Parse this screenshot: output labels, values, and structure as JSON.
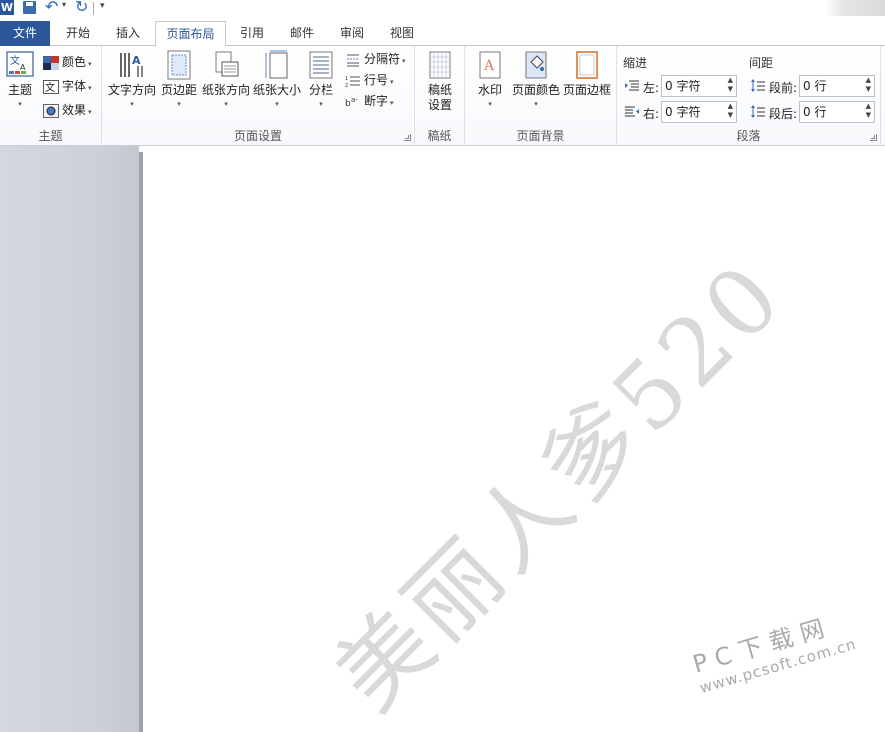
{
  "quick_access": {
    "app_icon_letter": "W",
    "icons": [
      "word-icon",
      "save-icon",
      "undo-icon",
      "redo-icon",
      "customize-icon"
    ]
  },
  "tabs": [
    {
      "label": "文件",
      "active": false
    },
    {
      "label": "开始",
      "active": false
    },
    {
      "label": "插入",
      "active": false
    },
    {
      "label": "页面布局",
      "active": true
    },
    {
      "label": "引用",
      "active": false
    },
    {
      "label": "邮件",
      "active": false
    },
    {
      "label": "审阅",
      "active": false
    },
    {
      "label": "视图",
      "active": false
    }
  ],
  "ribbon": {
    "theme_group": {
      "label": "主题",
      "theme_button": "主题",
      "colors": "颜色",
      "fonts": "字体",
      "effects": "效果"
    },
    "page_setup_group": {
      "label": "页面设置",
      "text_direction": "文字方向",
      "margins": "页边距",
      "orientation": "纸张方向",
      "size": "纸张大小",
      "columns": "分栏",
      "breaks": "分隔符",
      "line_numbers": "行号",
      "hyphenation": "断字"
    },
    "manuscript_group": {
      "label": "稿纸",
      "settings_line1": "稿纸",
      "settings_line2": "设置"
    },
    "page_background_group": {
      "label": "页面背景",
      "watermark": "水印",
      "page_color": "页面颜色",
      "page_borders": "页面边框"
    },
    "paragraph_group": {
      "label": "段落",
      "indent_heading": "缩进",
      "spacing_heading": "间距",
      "indent_left_label": "左:",
      "indent_left_value": "0 字符",
      "indent_right_label": "右:",
      "indent_right_value": "0 字符",
      "spacing_before_label": "段前:",
      "spacing_before_value": "0 行",
      "spacing_after_label": "段后:",
      "spacing_after_value": "0 行"
    }
  },
  "document": {
    "watermark_text": "美丽人爹520",
    "site_watermark_main": "PC下载网",
    "site_watermark_url": "www.pcsoft.com.cn"
  },
  "colors": {
    "file_tab": "#2b579a",
    "gutter": "#cdd1d7",
    "watermark": "#aaaaaa"
  }
}
